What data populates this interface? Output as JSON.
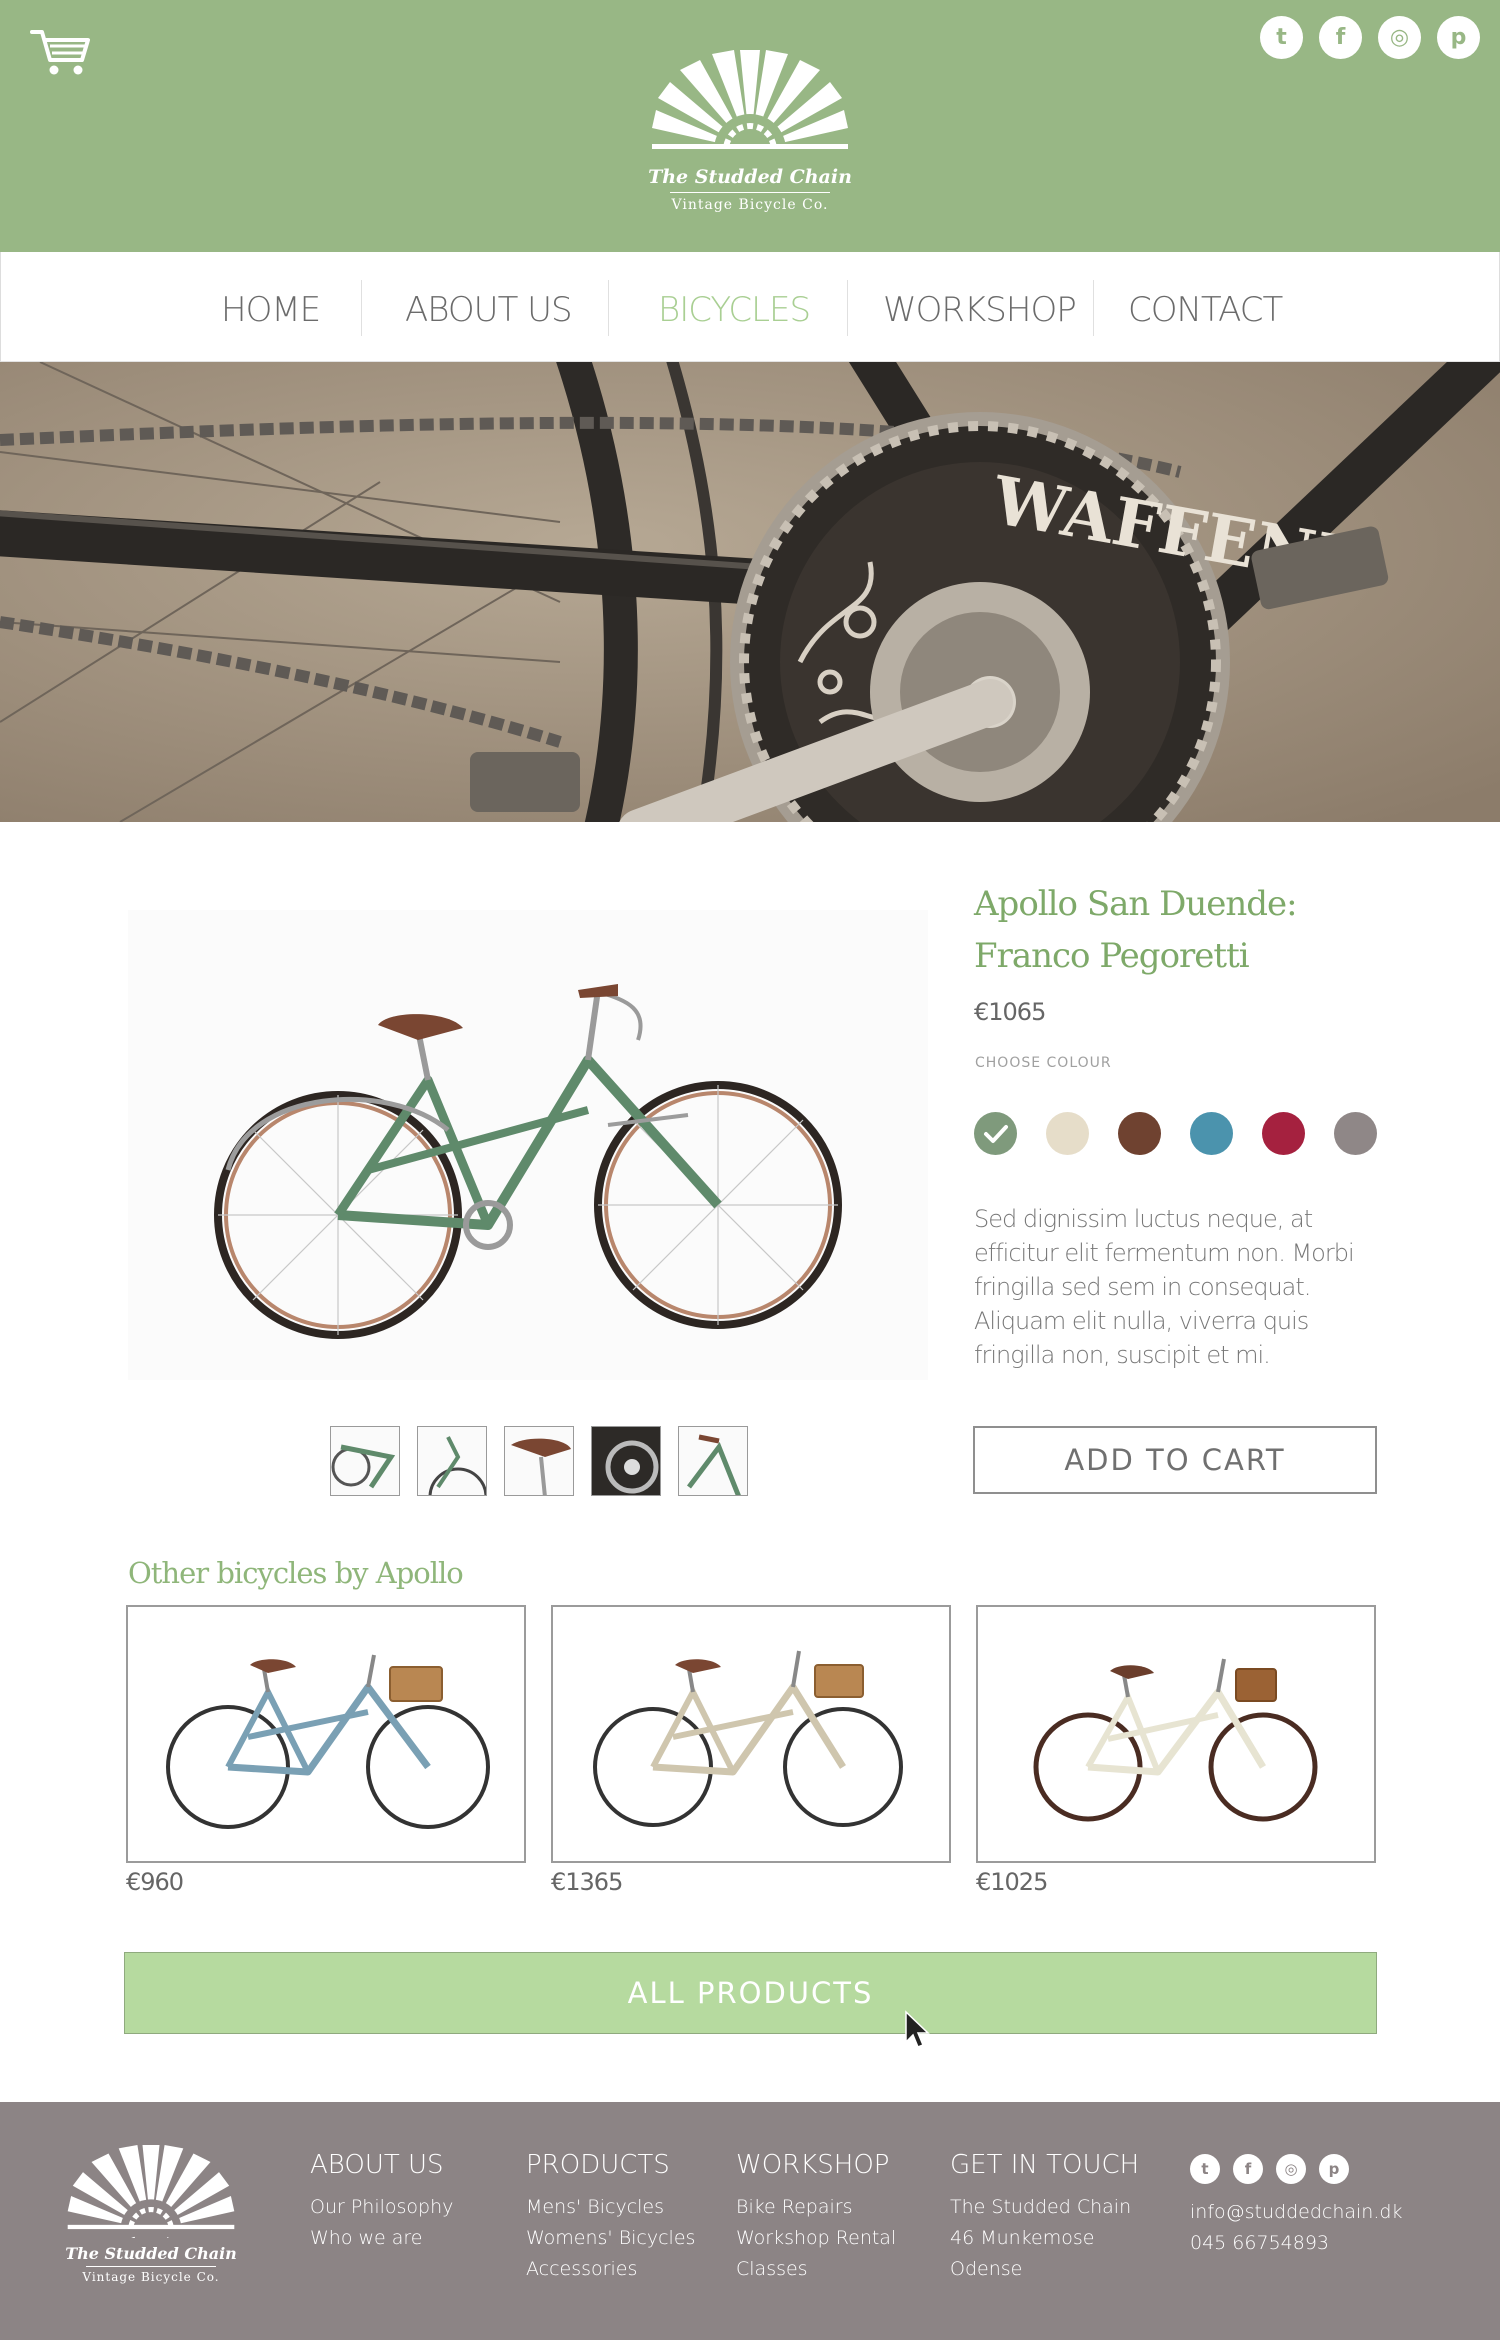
{
  "header": {
    "cart_icon": "shopping-cart-icon",
    "socials": [
      {
        "icon": "twitter-icon",
        "glyph": "t"
      },
      {
        "icon": "facebook-icon",
        "glyph": "f"
      },
      {
        "icon": "instagram-icon",
        "glyph": "◎"
      },
      {
        "icon": "pinterest-icon",
        "glyph": "p"
      }
    ],
    "logo": {
      "name": "The Studded Chain",
      "tagline": "Vintage Bicycle Co."
    },
    "background": "#98b785"
  },
  "nav": {
    "items": [
      {
        "label": "HOME",
        "active": false
      },
      {
        "label": "ABOUT US",
        "active": false
      },
      {
        "label": "BICYCLES",
        "active": true
      },
      {
        "label": "WORKSHOP",
        "active": false
      },
      {
        "label": "CONTACT",
        "active": false
      }
    ],
    "active_color": "#a9cf93"
  },
  "hero": {
    "chainring_text": "WAFFENR"
  },
  "product": {
    "title_line1": "Apollo San Duende:",
    "title_line2": "Franco Pegoretti",
    "price": "€1065",
    "choose_colour_label": "CHOOSE COLOUR",
    "colours": [
      {
        "hex": "#7f9a7c",
        "selected": true
      },
      {
        "hex": "#e6ddc9",
        "selected": false
      },
      {
        "hex": "#6f4230",
        "selected": false
      },
      {
        "hex": "#4b93ad",
        "selected": false
      },
      {
        "hex": "#a5213f",
        "selected": false
      },
      {
        "hex": "#8f8787",
        "selected": false
      }
    ],
    "description": "Sed dignissim luctus neque, at efficitur elit fermentum non. Morbi fringilla sed sem in consequat. Aliquam elit nulla, viverra quis fringilla non, suscipit et mi.",
    "add_to_cart_label": "ADD TO CART",
    "thumbnail_count": 5
  },
  "other": {
    "heading": "Other bicycles by Apollo",
    "items": [
      {
        "price": "€960",
        "frame_color": "#7aa0b4"
      },
      {
        "price": "€1365",
        "frame_color": "#cfc6ae"
      },
      {
        "price": "€1025",
        "frame_color": "#e7e4d2"
      }
    ]
  },
  "all_products_label": "ALL PRODUCTS",
  "footer": {
    "logo": {
      "name": "The Studded Chain",
      "tagline": "Vintage Bicycle Co."
    },
    "columns": [
      {
        "heading": "ABOUT US",
        "links": [
          "Our Philosophy",
          "Who we are"
        ]
      },
      {
        "heading": "PRODUCTS",
        "links": [
          "Mens' Bicycles",
          "Womens' Bicycles",
          "Accessories"
        ]
      },
      {
        "heading": "WORKSHOP",
        "links": [
          "Bike Repairs",
          "Workshop Rental",
          "Classes"
        ]
      },
      {
        "heading": "GET IN TOUCH",
        "links": [
          "The Studded Chain",
          "46 Munkemose",
          "Odense"
        ]
      }
    ],
    "contact": [
      "info@studdedchain.dk",
      "045 66754893"
    ],
    "socials": [
      {
        "icon": "twitter-icon",
        "glyph": "t"
      },
      {
        "icon": "facebook-icon",
        "glyph": "f"
      },
      {
        "icon": "instagram-icon",
        "glyph": "◎"
      },
      {
        "icon": "pinterest-icon",
        "glyph": "p"
      }
    ],
    "background": "#8c8485"
  }
}
